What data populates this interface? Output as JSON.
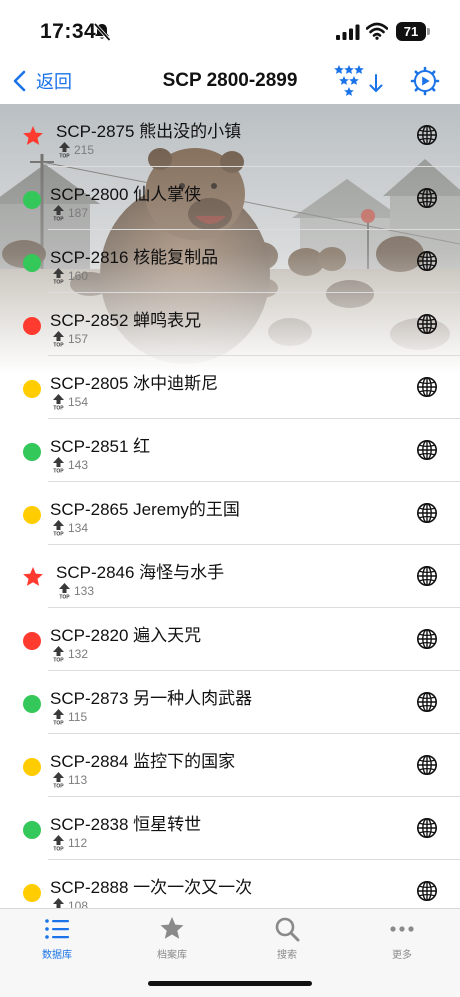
{
  "status_bar": {
    "time": "17:34",
    "battery": "71"
  },
  "nav": {
    "back_label": "返回",
    "title": "SCP 2800-2899"
  },
  "colors": {
    "accent": "#1a73e8",
    "green": "#34c759",
    "red": "#ff3b30",
    "yellow": "#ffcc00",
    "star": "#ff3b30"
  },
  "items": [
    {
      "title": "SCP-2875 熊出没的小镇",
      "rating": "215",
      "status": "star"
    },
    {
      "title": "SCP-2800 仙人掌侠",
      "rating": "187",
      "status": "green"
    },
    {
      "title": "SCP-2816 核能复制品",
      "rating": "160",
      "status": "green"
    },
    {
      "title": "SCP-2852 蝉鸣表兄",
      "rating": "157",
      "status": "red"
    },
    {
      "title": "SCP-2805 冰中迪斯尼",
      "rating": "154",
      "status": "yellow"
    },
    {
      "title": "SCP-2851 红",
      "rating": "143",
      "status": "green"
    },
    {
      "title": "SCP-2865 Jeremy的王国",
      "rating": "134",
      "status": "yellow"
    },
    {
      "title": "SCP-2846 海怪与水手",
      "rating": "133",
      "status": "star"
    },
    {
      "title": "SCP-2820 遍入天咒",
      "rating": "132",
      "status": "red"
    },
    {
      "title": "SCP-2873 另一种人肉武器",
      "rating": "115",
      "status": "green"
    },
    {
      "title": "SCP-2884 监控下的国家",
      "rating": "113",
      "status": "yellow"
    },
    {
      "title": "SCP-2838 恒星转世",
      "rating": "112",
      "status": "green"
    },
    {
      "title": "SCP-2888 一次一次又一次",
      "rating": "108",
      "status": "yellow"
    }
  ],
  "tabs": [
    {
      "label": "数据库",
      "icon": "list-icon",
      "active": true
    },
    {
      "label": "档案库",
      "icon": "star-icon",
      "active": false
    },
    {
      "label": "搜索",
      "icon": "search-icon",
      "active": false
    },
    {
      "label": "更多",
      "icon": "more-icon",
      "active": false
    }
  ]
}
